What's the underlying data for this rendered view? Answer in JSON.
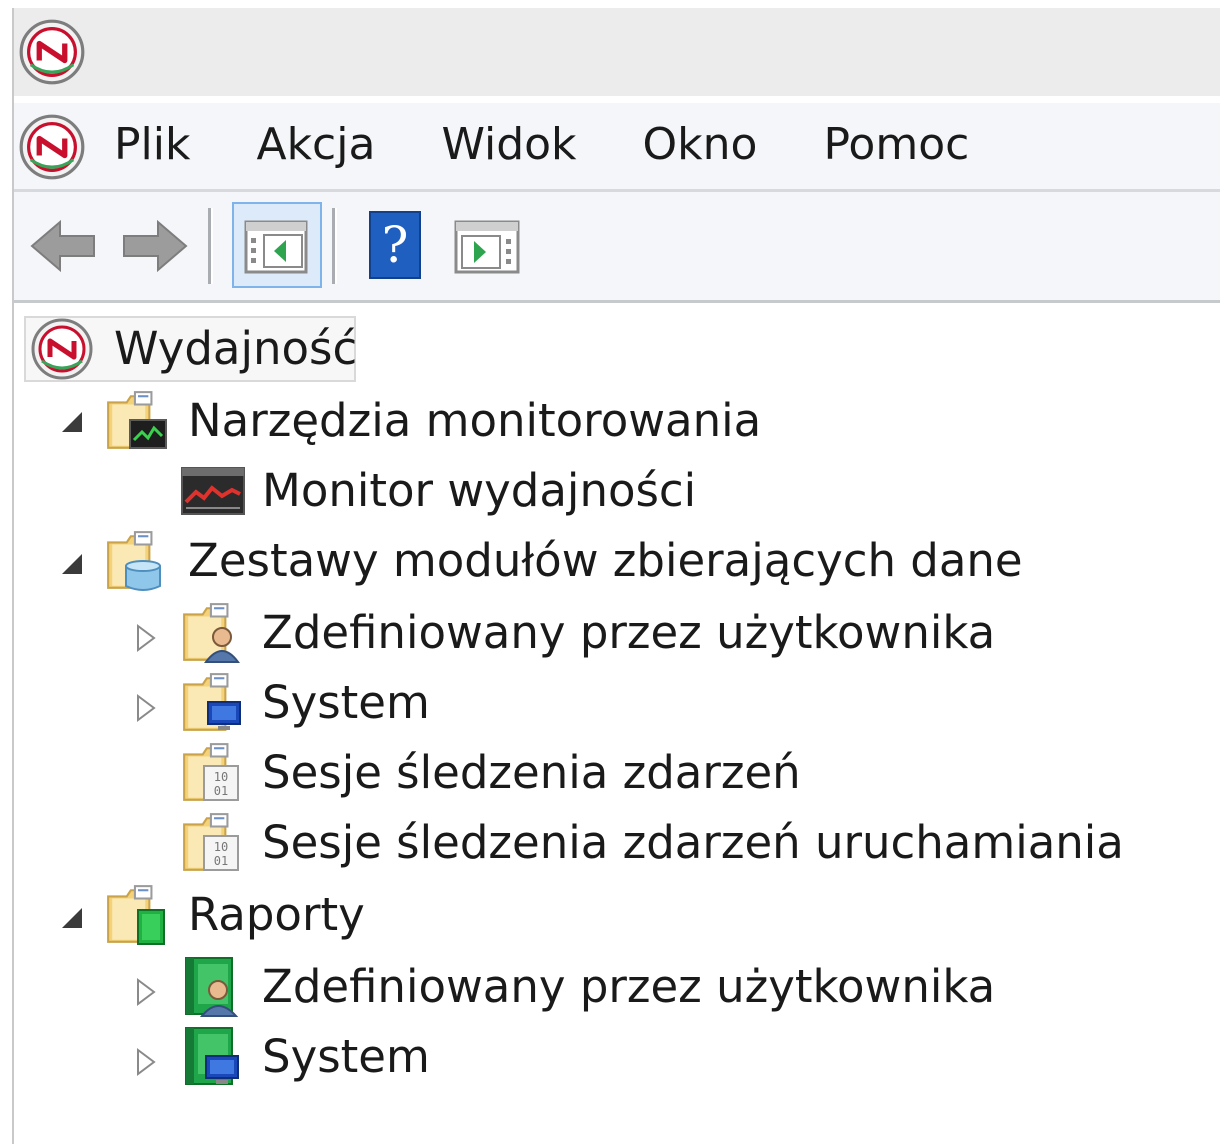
{
  "menubar": {
    "items": [
      {
        "id": "plik",
        "label": "Plik"
      },
      {
        "id": "akcja",
        "label": "Akcja"
      },
      {
        "id": "widok",
        "label": "Widok"
      },
      {
        "id": "okno",
        "label": "Okno"
      },
      {
        "id": "pomoc",
        "label": "Pomoc"
      }
    ]
  },
  "toolbar": {
    "buttons": [
      "back-arrow-icon",
      "forward-arrow-icon",
      "show-hide-console-tree-icon",
      "help-icon",
      "show-hide-action-pane-icon"
    ],
    "pressed": "show-hide-console-tree-icon"
  },
  "tree": {
    "root": {
      "label": "Wydajność",
      "icon": "performance-gauge-icon"
    },
    "monitoring_tools": {
      "label": "Narzędzia monitorowania",
      "expanded": true,
      "icon": "monitoring-folder-icon"
    },
    "performance_monitor": {
      "label": "Monitor wydajności",
      "icon": "performance-monitor-icon"
    },
    "data_collector_sets": {
      "label": "Zestawy modułów zbierających dane",
      "expanded": true,
      "icon": "data-collector-folder-icon"
    },
    "dcs_user_defined": {
      "label": "Zdefiniowany przez użytkownika",
      "expanded": false,
      "icon": "user-folder-icon"
    },
    "dcs_system": {
      "label": "System",
      "expanded": false,
      "icon": "system-folder-icon"
    },
    "event_trace_sessions": {
      "label": "Sesje śledzenia zdarzeń",
      "icon": "binary-folder-icon"
    },
    "startup_event_trace_sessions": {
      "label": "Sesje śledzenia zdarzeń uruchamiania",
      "icon": "binary-folder-icon"
    },
    "reports": {
      "label": "Raporty",
      "expanded": true,
      "icon": "reports-folder-icon"
    },
    "reports_user_defined": {
      "label": "Zdefiniowany przez użytkownika",
      "expanded": false,
      "icon": "user-report-icon"
    },
    "reports_system": {
      "label": "System",
      "expanded": false,
      "icon": "system-report-icon"
    }
  }
}
